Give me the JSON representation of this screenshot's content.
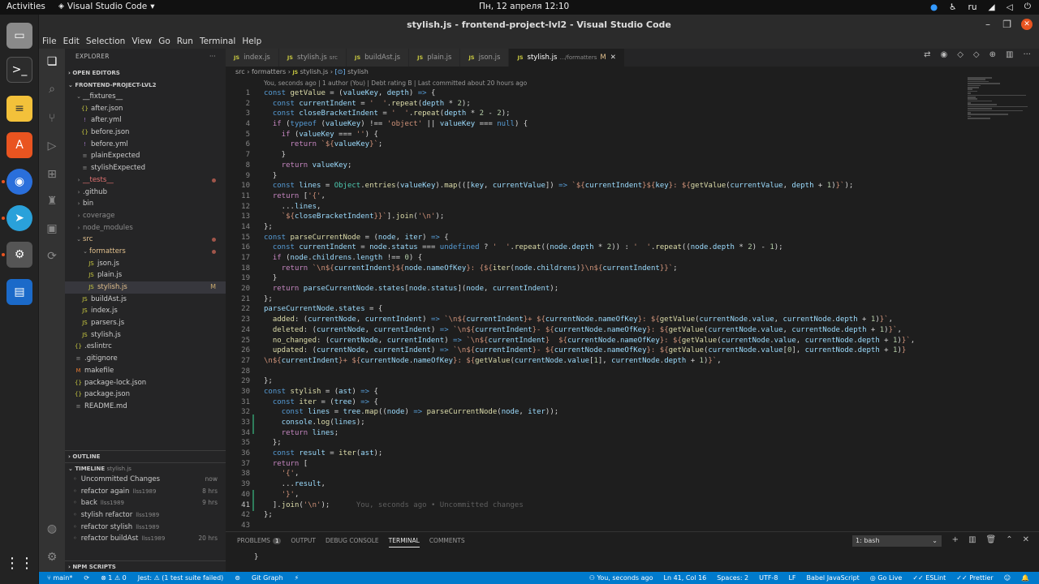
{
  "topbar": {
    "activities": "Activities",
    "app": "Visual Studio Code",
    "app_chev": "▾",
    "clock": "Пн, 12 апреля  12:10",
    "lang": "ru"
  },
  "window": {
    "title": "stylish.js - frontend-project-lvl2 - Visual Studio Code"
  },
  "menu": [
    "File",
    "Edit",
    "Selection",
    "View",
    "Go",
    "Run",
    "Terminal",
    "Help"
  ],
  "sidebar": {
    "explorer_label": "EXPLORER",
    "open_editors": "OPEN EDITORS",
    "project": "FRONTEND-PROJECT-LVL2",
    "tree": [
      {
        "label": "__fixtures__",
        "kind": "folder-open",
        "depth": 1,
        "color": "normal"
      },
      {
        "label": "after.json",
        "kind": "json",
        "depth": 2
      },
      {
        "label": "after.yml",
        "kind": "yml",
        "depth": 2
      },
      {
        "label": "before.json",
        "kind": "json",
        "depth": 2
      },
      {
        "label": "before.yml",
        "kind": "yml",
        "depth": 2
      },
      {
        "label": "plainExpected",
        "kind": "txt",
        "depth": 2
      },
      {
        "label": "stylishExpected",
        "kind": "txt",
        "depth": 2
      },
      {
        "label": "__tests__",
        "kind": "folder",
        "depth": 1,
        "color": "red",
        "dot": true
      },
      {
        "label": ".github",
        "kind": "folder",
        "depth": 1
      },
      {
        "label": "bin",
        "kind": "folder",
        "depth": 1
      },
      {
        "label": "coverage",
        "kind": "folder",
        "depth": 1,
        "color": "gray"
      },
      {
        "label": "node_modules",
        "kind": "folder",
        "depth": 1,
        "color": "gray"
      },
      {
        "label": "src",
        "kind": "folder-open",
        "depth": 1,
        "color": "mod",
        "dot": true
      },
      {
        "label": "formatters",
        "kind": "folder-open",
        "depth": 2,
        "color": "mod",
        "dot": true
      },
      {
        "label": "json.js",
        "kind": "js",
        "depth": 3
      },
      {
        "label": "plain.js",
        "kind": "js",
        "depth": 3
      },
      {
        "label": "stylish.js",
        "kind": "js",
        "depth": 3,
        "color": "mod",
        "mark": "M",
        "selected": true
      },
      {
        "label": "buildAst.js",
        "kind": "js",
        "depth": 2
      },
      {
        "label": "index.js",
        "kind": "js",
        "depth": 2
      },
      {
        "label": "parsers.js",
        "kind": "js",
        "depth": 2
      },
      {
        "label": "stylish.js",
        "kind": "js",
        "depth": 2
      },
      {
        "label": ".eslintrc",
        "kind": "json",
        "depth": 1
      },
      {
        "label": ".gitignore",
        "kind": "txt",
        "depth": 1
      },
      {
        "label": "makefile",
        "kind": "mk",
        "depth": 1
      },
      {
        "label": "package-lock.json",
        "kind": "json",
        "depth": 1
      },
      {
        "label": "package.json",
        "kind": "json",
        "depth": 1
      },
      {
        "label": "README.md",
        "kind": "txt",
        "depth": 1
      }
    ],
    "outline": "OUTLINE",
    "timeline": "TIMELINE",
    "timeline_file": "stylish.js",
    "timeline_items": [
      {
        "label": "Uncommitted Changes",
        "author": "",
        "time": "now"
      },
      {
        "label": "refactor again",
        "author": "llss1989",
        "time": "8 hrs"
      },
      {
        "label": "back",
        "author": "llss1989",
        "time": "9 hrs"
      },
      {
        "label": "stylish refactor",
        "author": "llss1989",
        "time": ""
      },
      {
        "label": "refactor stylish",
        "author": "llss1989",
        "time": ""
      },
      {
        "label": "refactor buildAst",
        "author": "llss1989",
        "time": "20 hrs"
      }
    ],
    "npm": "NPM SCRIPTS"
  },
  "tabs": [
    {
      "label": "index.js",
      "sub": "",
      "active": false
    },
    {
      "label": "stylish.js",
      "sub": "src",
      "active": false
    },
    {
      "label": "buildAst.js",
      "sub": "",
      "active": false
    },
    {
      "label": "plain.js",
      "sub": "",
      "active": false
    },
    {
      "label": "json.js",
      "sub": "",
      "active": false
    },
    {
      "label": "stylish.js",
      "sub": ".../formatters",
      "active": true,
      "mark": "M"
    }
  ],
  "breadcrumb": {
    "a": "src",
    "b": "formatters",
    "c": "stylish.js",
    "d": "stylish",
    "sep": "›"
  },
  "blame": "You, seconds ago | 1 author (You) | Debt rating B | Last committed about 20 hours ago",
  "inline_blame": "You, seconds ago • Uncommitted changes",
  "panel": {
    "tabs": [
      "PROBLEMS",
      "OUTPUT",
      "DEBUG CONSOLE",
      "TERMINAL",
      "COMMENTS"
    ],
    "problems_count": "1",
    "active": "TERMINAL",
    "terminal_select": "1: bash",
    "terminal_text": "}"
  },
  "status": {
    "branch": "main*",
    "sync": "⟳",
    "errors": "⊗ 1 ⚠ 0",
    "jest": "Jest: ⚠ (1 test suite failed)",
    "jest_icon": "⊚",
    "gitgraph": "Git Graph",
    "git_icon": "⚡",
    "blame": "You, seconds ago",
    "pos": "Ln 41, Col 16",
    "spaces": "Spaces: 2",
    "enc": "UTF-8",
    "eol": "LF",
    "lang": "Babel JavaScript",
    "live": "Go Live",
    "eslint": "ESLint",
    "prettier": "Prettier"
  },
  "code_lines": [
    "1",
    "2",
    "3",
    "4",
    "5",
    "6",
    "7",
    "8",
    "9",
    "10",
    "11",
    "12",
    "13",
    "14",
    "15",
    "16",
    "17",
    "18",
    "19",
    "20",
    "21",
    "22",
    "23",
    "24",
    "25",
    "26",
    "27",
    "28",
    "29",
    "30",
    "31",
    "32",
    "33",
    "34",
    "35",
    "36",
    "37",
    "38",
    "39",
    "40",
    "41",
    "42",
    "43"
  ],
  "colors": {
    "accent": "#007acc",
    "bg": "#1e1e1e",
    "sidebar": "#252526",
    "modified": "#e2c08d",
    "untracked": "#e57373"
  }
}
